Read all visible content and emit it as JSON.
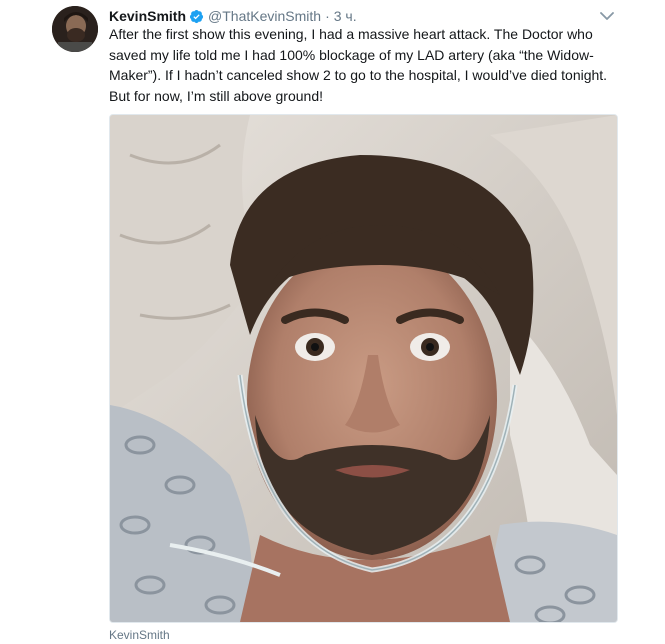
{
  "tweet": {
    "display_name": "KevinSmith",
    "verified_icon": "verified-badge-icon",
    "handle": "@ThatKevinSmith",
    "separator": "·",
    "timestamp": "3 ч.",
    "caret_icon": "chevron-down-icon",
    "text": "After the first show this evening, I had a massive heart attack. The Doctor who saved my life told me I had 100% blockage of my LAD artery (aka “the Widow-Maker”). If I hadn’t canceled show 2 to go to the hospital, I would’ve died tonight. But for now, I’m still above ground!",
    "media_credit": "KevinSmith"
  },
  "colors": {
    "verified": "#1da1f2",
    "secondary_text": "#657786",
    "primary_text": "#14171a",
    "border": "#e1e8ed"
  }
}
